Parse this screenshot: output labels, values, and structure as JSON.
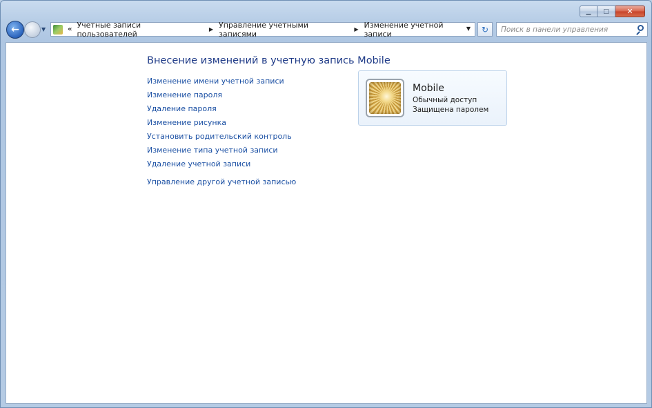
{
  "window": {
    "caption_buttons": {
      "minimize_icon": "minimize-icon",
      "maximize_icon": "maximize-icon",
      "close_icon": "close-icon"
    }
  },
  "navbar": {
    "breadcrumb": [
      "Учетные записи пользователей",
      "Управление учетными записями",
      "Изменение учетной записи"
    ],
    "search_placeholder": "Поиск в панели управления"
  },
  "main": {
    "title": "Внесение изменений в учетную запись Mobile",
    "links": [
      "Изменение имени учетной записи",
      "Изменение пароля",
      "Удаление пароля",
      "Изменение рисунка",
      "Установить родительский контроль",
      "Изменение типа учетной записи",
      "Удаление учетной записи"
    ],
    "other_link": "Управление другой учетной записью"
  },
  "account": {
    "name": "Mobile",
    "type": "Обычный доступ",
    "status": "Защищена паролем"
  },
  "colors": {
    "link": "#1a4fa3",
    "title": "#1e3a87"
  }
}
